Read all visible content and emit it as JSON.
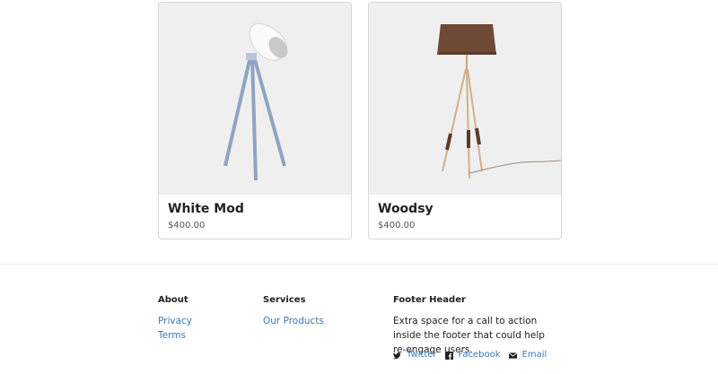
{
  "products": [
    {
      "name": "White Mod",
      "price": "$400.00"
    },
    {
      "name": "Woodsy",
      "price": "$400.00"
    }
  ],
  "footer": {
    "about": {
      "header": "About",
      "links": [
        "Privacy",
        "Terms"
      ]
    },
    "services": {
      "header": "Services",
      "links": [
        "Our Products"
      ]
    },
    "cta": {
      "header": "Footer Header",
      "text": "Extra space for a call to action inside the footer that could help re-engage users.",
      "social": [
        {
          "label": "Twitter",
          "icon": "twitter-icon"
        },
        {
          "label": "Facebook",
          "icon": "facebook-icon"
        },
        {
          "label": "Email",
          "icon": "email-icon"
        }
      ]
    }
  },
  "colors": {
    "link": "#3a7ab8",
    "card_image_bg": "#efefef"
  }
}
